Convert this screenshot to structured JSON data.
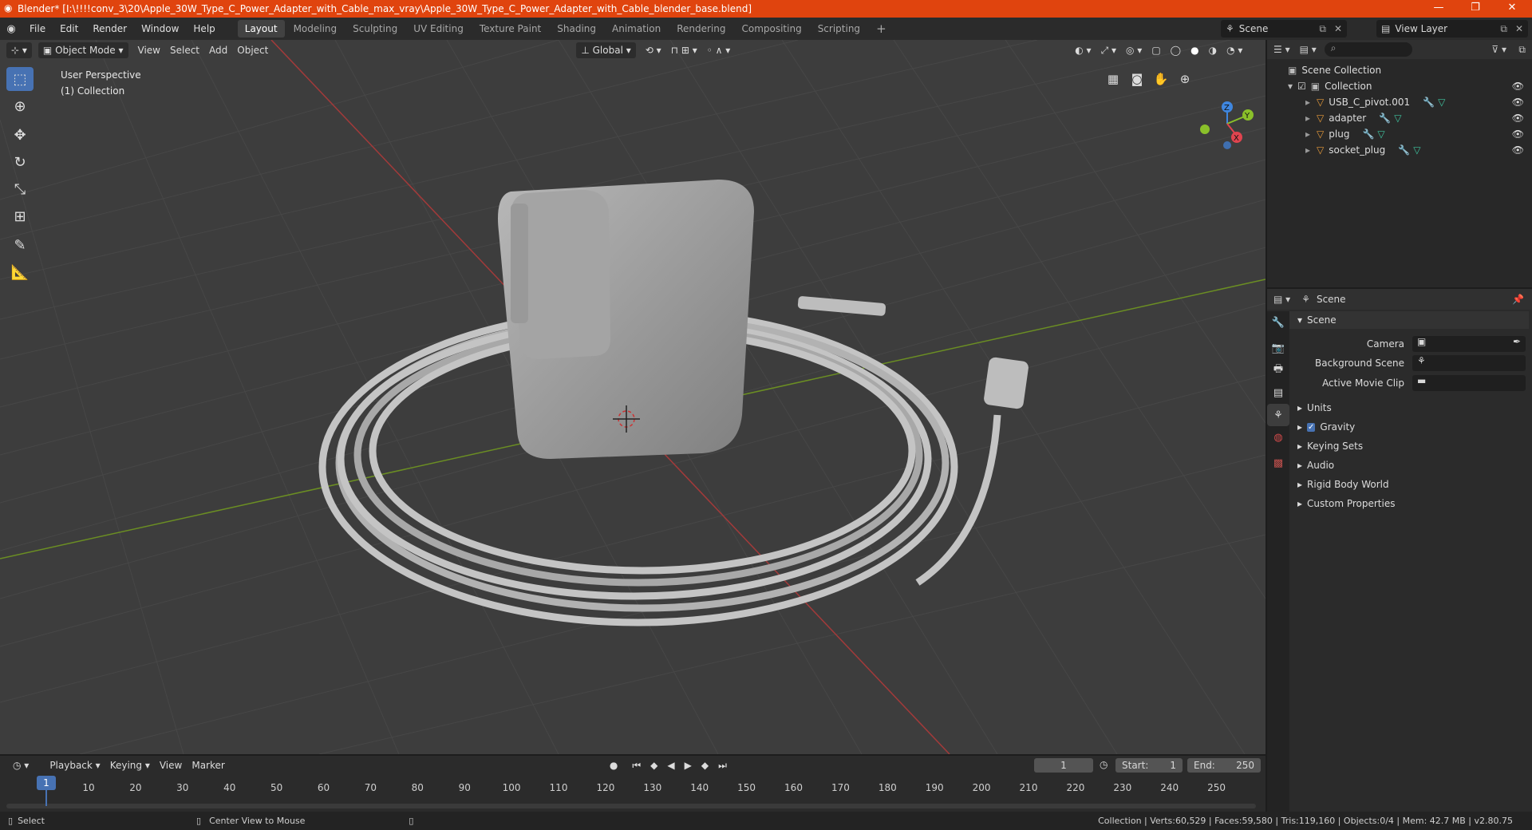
{
  "window": {
    "title": "Blender* [I:\\!!!!conv_3\\20\\Apple_30W_Type_C_Power_Adapter_with_Cable_max_vray\\Apple_30W_Type_C_Power_Adapter_with_Cable_blender_base.blend]",
    "minimize": "—",
    "maximize": "❐",
    "close": "✕"
  },
  "menu": {
    "file": "File",
    "edit": "Edit",
    "render": "Render",
    "window": "Window",
    "help": "Help"
  },
  "workspaces": [
    "Layout",
    "Modeling",
    "Sculpting",
    "UV Editing",
    "Texture Paint",
    "Shading",
    "Animation",
    "Rendering",
    "Compositing",
    "Scripting"
  ],
  "active_workspace": "Layout",
  "scene_selector": "Scene",
  "view_layer": "View Layer",
  "viewport": {
    "mode": "Object Mode",
    "view": "View",
    "select": "Select",
    "add": "Add",
    "object": "Object",
    "orientation": "Global",
    "perspective": "User Perspective",
    "collection": "(1) Collection"
  },
  "gizmo": {
    "x": "X",
    "y": "Y",
    "z": "Z"
  },
  "outliner": {
    "root": "Scene Collection",
    "collection": "Collection",
    "items": [
      "USB_C_pivot.001",
      "adapter",
      "plug",
      "socket_plug"
    ]
  },
  "properties": {
    "context": "Scene",
    "panel": "Scene",
    "camera": "Camera",
    "background_scene": "Background Scene",
    "active_movie_clip": "Active Movie Clip",
    "sections": [
      "Units",
      "Gravity",
      "Keying Sets",
      "Audio",
      "Rigid Body World",
      "Custom Properties"
    ]
  },
  "timeline": {
    "playback": "Playback",
    "keying": "Keying",
    "view": "View",
    "marker": "Marker",
    "current_frame": "1",
    "start_label": "Start:",
    "start": "1",
    "end_label": "End:",
    "end": "250",
    "ticks": [
      "1",
      "10",
      "20",
      "30",
      "40",
      "50",
      "60",
      "70",
      "80",
      "90",
      "100",
      "110",
      "120",
      "130",
      "140",
      "150",
      "160",
      "170",
      "180",
      "190",
      "200",
      "210",
      "220",
      "230",
      "240",
      "250"
    ]
  },
  "status": {
    "select": "Select",
    "center_view": "Center View to Mouse",
    "stats": "Collection | Verts:60,529 | Faces:59,580 | Tris:119,160 | Objects:0/4 | Mem: 42.7 MB | v2.80.75"
  },
  "colors": {
    "accent": "#4772b3",
    "titlebar": "#e0440e",
    "x_axis": "#e0444f",
    "y_axis": "#8ac02a",
    "z_axis": "#3f87e0"
  }
}
